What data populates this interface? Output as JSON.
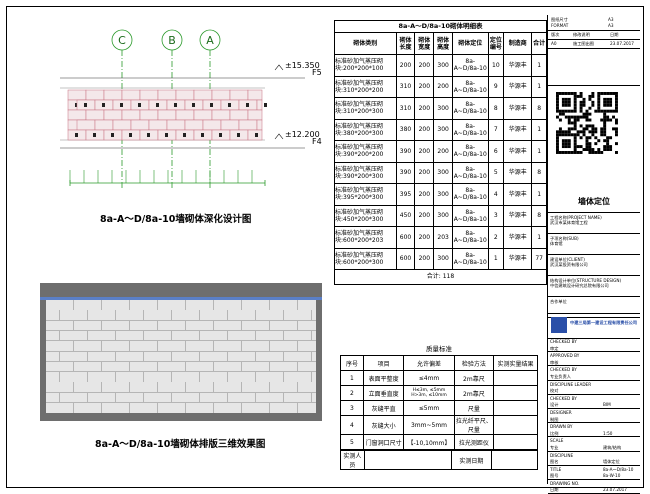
{
  "elevation": {
    "axes": [
      "C",
      "B",
      "A"
    ],
    "levels": [
      {
        "value": "±15.350",
        "floor": "F5"
      },
      {
        "value": "±12.200",
        "floor": "F4"
      }
    ],
    "caption": "8a-A～D/8a-10墙砌体深化设计图"
  },
  "render3d": {
    "caption": "8a-A～D/8a-10墙砌体排版三维效果图"
  },
  "block_table": {
    "title": "8a-A～D/8a-10砌体明细表",
    "headers": [
      "砌体类别",
      "砌体长度",
      "砌体宽度",
      "砌体高度",
      "砌体定位",
      "定位编号",
      "制造商",
      "合计"
    ],
    "rows": [
      [
        "标准砂加气蒸压砌块:200*200*100",
        "200",
        "200",
        "300",
        "8a-A~D/8a-10",
        "10",
        "华源丰",
        "1"
      ],
      [
        "标准砂加气蒸压砌块:310*200*200",
        "310",
        "200",
        "200",
        "8a-A~D/8a-10",
        "9",
        "华源丰",
        "1"
      ],
      [
        "标准砂加气蒸压砌块:310*200*300",
        "310",
        "200",
        "300",
        "8a-A~D/8a-10",
        "8",
        "华源丰",
        "8"
      ],
      [
        "标准砂加气蒸压砌块:380*200*300",
        "380",
        "200",
        "300",
        "8a-A~D/8a-10",
        "7",
        "华源丰",
        "1"
      ],
      [
        "标准砂加气蒸压砌块:390*200*200",
        "390",
        "200",
        "200",
        "8a-A~D/8a-10",
        "6",
        "华源丰",
        "1"
      ],
      [
        "标准砂加气蒸压砌块:390*200*300",
        "390",
        "200",
        "300",
        "8a-A~D/8a-10",
        "5",
        "华源丰",
        "8"
      ],
      [
        "标准砂加气蒸压砌块:395*200*300",
        "395",
        "200",
        "300",
        "8a-A~D/8a-10",
        "4",
        "华源丰",
        "1"
      ],
      [
        "标准砂加气蒸压砌块:450*200*300",
        "450",
        "200",
        "300",
        "8a-A~D/8a-10",
        "3",
        "华源丰",
        "8"
      ],
      [
        "标准砂加气蒸压砌块:600*200*203",
        "600",
        "200",
        "203",
        "8a-A~D/8a-10",
        "2",
        "华源丰",
        "1"
      ],
      [
        "标准砂加气蒸压砌块:600*200*300",
        "600",
        "200",
        "300",
        "8a-A~D/8a-10",
        "1",
        "华源丰",
        "77"
      ]
    ],
    "total": "合计: 118"
  },
  "quality_table": {
    "title": "质量标准",
    "headers": [
      "序号",
      "项目",
      "允许偏差",
      "检验方法",
      "实测实量结果"
    ],
    "rows": [
      [
        "1",
        "表面平整度",
        "≤4mm",
        "2m靠尺",
        ""
      ],
      [
        "2",
        "立面垂直度",
        "H≤3m, ≤5mm  H>3m, ≤10mm",
        "2m靠尺",
        ""
      ],
      [
        "3",
        "灰缝平直",
        "≤5mm",
        "尺量",
        ""
      ],
      [
        "4",
        "灰缝大小",
        "3mm~5mm",
        "拉光纤平尺、尺量",
        ""
      ],
      [
        "5",
        "门窗洞口尺寸",
        "【-10,10mm】",
        "拉光测距仪",
        ""
      ]
    ],
    "footer": [
      "实测人员",
      "",
      "实测日期",
      ""
    ]
  },
  "title_block": {
    "top": [
      "图纸尺寸",
      "A3",
      "FORMAT",
      "A3",
      "版次",
      "修改说明",
      "日期"
    ],
    "rev": [
      "A0",
      "施工图出图",
      "23.07.2017"
    ],
    "drawing_title": "墙体定位",
    "fields": [
      {
        "label": "工程名称(PROJECT NAME)",
        "value": "武汉市某体育馆工程"
      },
      {
        "label": "子项名称(SUB)",
        "value": "体育馆"
      },
      {
        "label": "建设单位(CLIENT)",
        "value": "武汉某投资有限公司"
      },
      {
        "label": "结构设计单位(STRUCTURE DESIGN)",
        "value": "中信建筑设计研究总院有限公司"
      },
      {
        "label": "合作单位",
        "value": ""
      }
    ],
    "company": "中建三局第一建设工程有限责任公司",
    "sign": [
      [
        "CHECKED BY",
        ""
      ],
      [
        "审定",
        ""
      ],
      [
        "APPROVED BY",
        ""
      ],
      [
        "审核",
        ""
      ],
      [
        "CHECKED BY",
        ""
      ],
      [
        "专业负责人",
        ""
      ],
      [
        "DISCIPLINE LEADER",
        ""
      ],
      [
        "校对",
        ""
      ],
      [
        "CHECKED BY",
        ""
      ],
      [
        "设计",
        "BIM"
      ],
      [
        "DESIGNER",
        ""
      ],
      [
        "制图",
        ""
      ],
      [
        "DRAWN BY",
        ""
      ],
      [
        "比例",
        "1:50"
      ],
      [
        "SCALE",
        ""
      ],
      [
        "专业",
        "建筑/结构"
      ],
      [
        "DISCIPLINE",
        ""
      ],
      [
        "图名",
        "墙体定位"
      ],
      [
        "TITLE",
        "8a-A～D/8a-10"
      ],
      [
        "图号",
        "8a-W-10"
      ],
      [
        "DRAWING NO.",
        ""
      ],
      [
        "日期",
        "23.07.2017"
      ]
    ]
  }
}
